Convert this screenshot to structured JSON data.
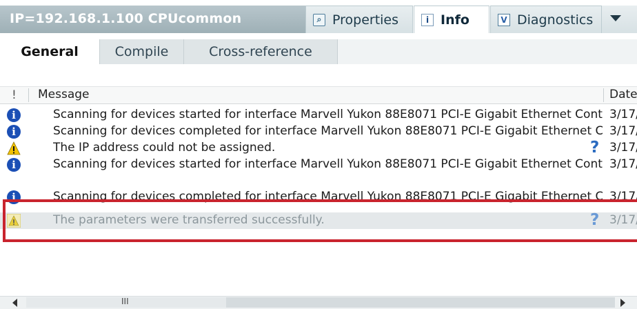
{
  "window": {
    "title": "IP=192.168.1.100 CPUcommon"
  },
  "inspector_tabs": [
    {
      "label": "Properties",
      "icon": "properties-icon",
      "active": false
    },
    {
      "label": "Info",
      "icon": "info-icon",
      "active": true
    },
    {
      "label": "Diagnostics",
      "icon": "diagnostics-icon",
      "active": false
    }
  ],
  "subtabs": [
    {
      "label": "General",
      "active": true
    },
    {
      "label": "Compile",
      "active": false
    },
    {
      "label": "Cross-reference",
      "active": false
    }
  ],
  "table": {
    "columns": {
      "flag": "!",
      "message": "Message",
      "date": "Date"
    },
    "rows": [
      {
        "type": "info",
        "message": "Scanning for devices started for interface Marvell Yukon 88E8071 PCI-E Gigabit Ethernet Contr",
        "help": false,
        "date": "3/17/"
      },
      {
        "type": "info",
        "message": "Scanning for devices completed for interface Marvell Yukon 88E8071 PCI-E Gigabit Ethernet C",
        "help": false,
        "date": "3/17/"
      },
      {
        "type": "warning",
        "message": "The IP address could not be assigned.",
        "help": true,
        "date": "3/17/"
      },
      {
        "type": "info",
        "message": "Scanning for devices started for interface Marvell Yukon 88E8071 PCI-E Gigabit Ethernet Contr",
        "help": false,
        "date": "3/17/"
      },
      {
        "type": "info",
        "message": "Scanning for devices completed for interface Marvell Yukon 88E8071 PCI-E Gigabit Ethernet C",
        "help": false,
        "date": "3/17/"
      },
      {
        "type": "warning",
        "message": "The parameters were transferred successfully.",
        "help": true,
        "date": "3/17/",
        "dimmed": true
      }
    ],
    "help_glyph": "?"
  },
  "scrollbar": {
    "grip": "III"
  },
  "colors": {
    "highlight": "#c9242e",
    "info_icon": "#1b4fb5",
    "warning_icon": "#f2c200",
    "help": "#2b6bc0"
  }
}
